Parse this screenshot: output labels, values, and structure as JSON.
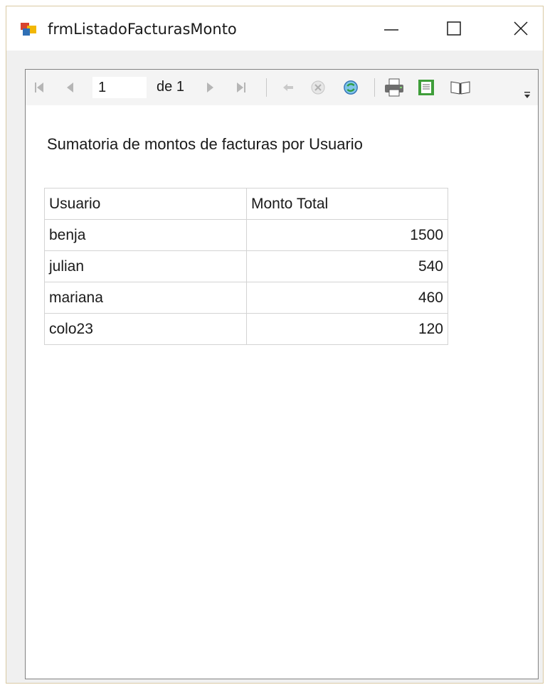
{
  "window": {
    "title": "frmListadoFacturasMonto",
    "icon": "form-app-icon"
  },
  "toolbar": {
    "page_current": "1",
    "page_of_label": "de",
    "page_total": "1",
    "icons": [
      "first-page-icon",
      "previous-page-icon",
      "next-page-icon",
      "last-page-icon",
      "back-icon",
      "stop-icon",
      "refresh-icon",
      "print-icon",
      "print-layout-icon",
      "page-setup-icon",
      "overflow-chevron-icon"
    ]
  },
  "report": {
    "title": "Sumatoria de montos de facturas por Usuario",
    "columns": [
      "Usuario",
      "Monto Total"
    ],
    "rows": [
      {
        "usuario": "benja",
        "monto": "1500"
      },
      {
        "usuario": "julian",
        "monto": "540"
      },
      {
        "usuario": "mariana",
        "monto": "460"
      },
      {
        "usuario": "colo23",
        "monto": "120"
      }
    ]
  },
  "colors": {
    "accent_green": "#2e9b3e",
    "accent_blue": "#2f6fb5",
    "toolbar_bg": "#f4f4f4",
    "window_bg": "#f0f0f0"
  }
}
